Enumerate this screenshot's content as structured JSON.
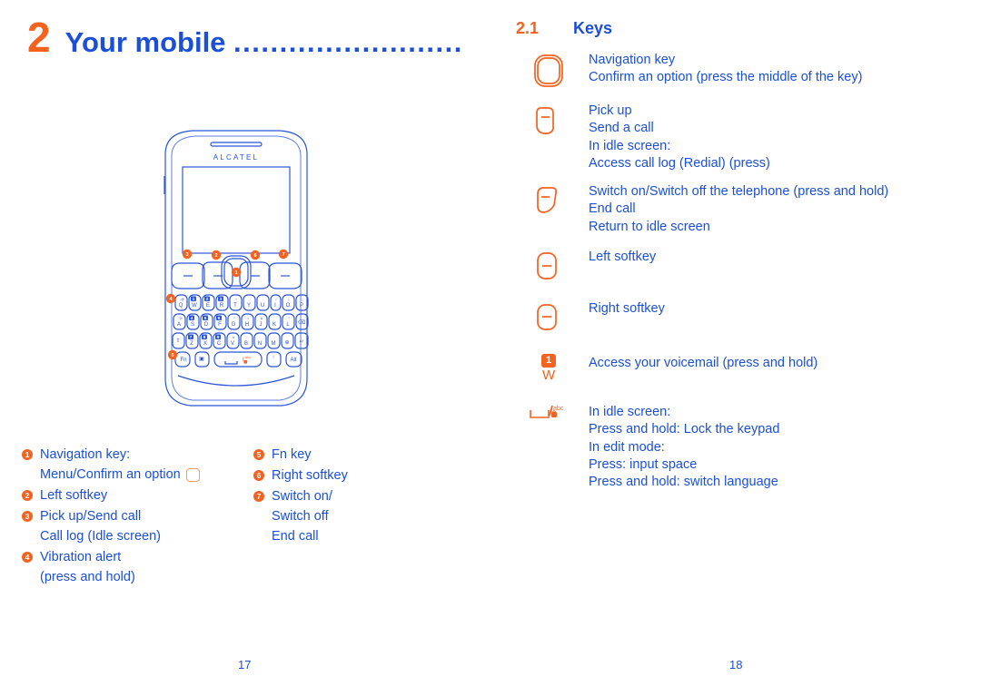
{
  "chapter": {
    "number": "2",
    "title": "Your mobile",
    "dots": "........................."
  },
  "section": {
    "number": "2.1",
    "title": "Keys"
  },
  "phone": {
    "brand": "ALCATEL",
    "callouts": [
      "1",
      "2",
      "3",
      "4",
      "5",
      "6",
      "7"
    ],
    "keyboard_rows": [
      [
        "Q",
        "W",
        "E",
        "R",
        "T",
        "Y",
        "U",
        "I",
        "O",
        "P"
      ],
      [
        "A",
        "S",
        "D",
        "F",
        "G",
        "H",
        "J",
        "K",
        "L",
        "⌫"
      ],
      [
        "⇧",
        "Z",
        "X",
        "C",
        "V",
        "B",
        "N",
        "M",
        "⊕",
        "↵"
      ],
      [
        "Fn",
        "▣",
        "space",
        "?",
        "Alt"
      ]
    ],
    "key_badges": {
      "W": "1",
      "E": "2",
      "R": "3",
      "S": "4",
      "D": "5",
      "F": "6",
      "Z": "7",
      "X": "8",
      "C": "9"
    },
    "key_superscripts": {
      "Q": "@",
      "T": "+",
      "U": "-",
      "I": "/",
      "P": "|",
      "A": "%",
      "G": "*",
      "H": "=",
      "J": "&",
      "L": "\"",
      "Z": "'",
      "V": "#",
      "B": ":",
      "N": ";",
      "M": "."
    },
    "space_labels": {
      "abc": "abc",
      "lock": "lock-icon"
    }
  },
  "legend": {
    "column_one": [
      {
        "marker": "1",
        "lines": [
          "Navigation key:",
          "Menu/Confirm an option"
        ],
        "icon_after": "nav-key-outline"
      },
      {
        "marker": "2",
        "lines": [
          "Left softkey"
        ]
      },
      {
        "marker": "3",
        "lines": [
          "Pick up/Send call",
          "Call log (Idle screen)"
        ]
      },
      {
        "marker": "4",
        "lines": [
          "Vibration alert",
          "(press and hold)"
        ]
      }
    ],
    "column_two": [
      {
        "marker": "5",
        "lines": [
          "Fn key"
        ]
      },
      {
        "marker": "6",
        "lines": [
          "Right softkey"
        ]
      },
      {
        "marker": "7",
        "lines": [
          "Switch on/",
          "Switch off",
          "End call"
        ]
      }
    ]
  },
  "keys_list": [
    {
      "icon": "navigation-key-icon",
      "lines": [
        "Navigation key",
        "Confirm an option (press the middle of the key)"
      ]
    },
    {
      "icon": "pick-up-key-icon",
      "lines": [
        "Pick up",
        "Send a call",
        "In idle screen:",
        "Access call log (Redial) (press)"
      ]
    },
    {
      "icon": "power-end-key-icon",
      "lines": [
        "Switch on/Switch off the telephone (press and hold)",
        "End call",
        "Return to idle screen"
      ]
    },
    {
      "icon": "left-softkey-icon",
      "lines": [
        "Left softkey"
      ]
    },
    {
      "icon": "right-softkey-icon",
      "lines": [
        "Right softkey"
      ]
    },
    {
      "icon": "voicemail-key-icon",
      "badge": "1",
      "letter": "W",
      "lines": [
        "Access your voicemail (press and hold)"
      ]
    },
    {
      "icon": "space-key-icon",
      "lines": [
        "In idle screen:",
        "Press and hold: Lock the keypad",
        "In edit mode:",
        "Press: input space",
        "Press and hold: switch language"
      ]
    }
  ],
  "page_numbers": {
    "left": "17",
    "right": "18"
  },
  "colors": {
    "blue": "#1b4fd8",
    "orange": "#f4621f",
    "icon_orange": "#f4621f",
    "light_orange": "#f79b6e"
  }
}
